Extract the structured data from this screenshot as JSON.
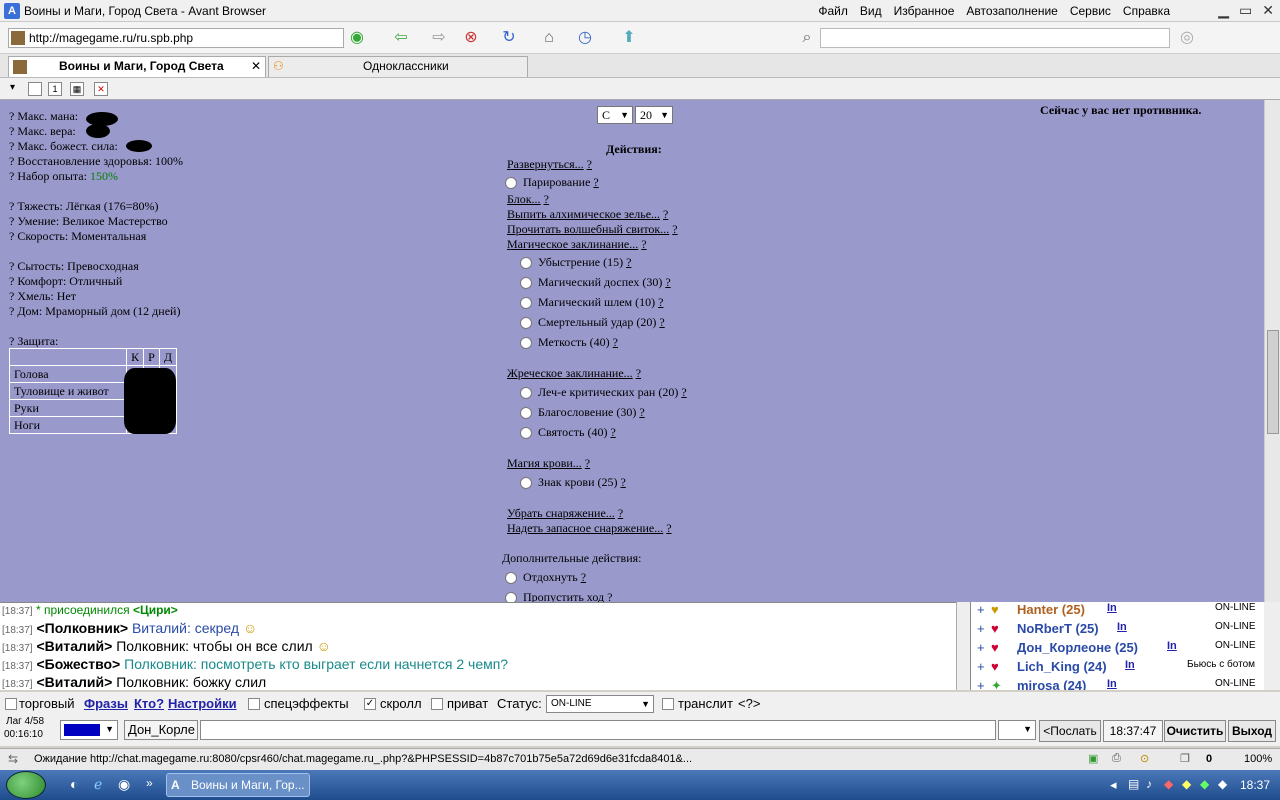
{
  "window": {
    "title": "Воины и Маги, Город Света - Avant Browser"
  },
  "menu": [
    "Файл",
    "Вид",
    "Избранное",
    "Автозаполнение",
    "Сервис",
    "Справка"
  ],
  "address": {
    "url": "http://magegame.ru/ru.spb.php"
  },
  "tabs": [
    {
      "label": "Воины и Маги, Город Света"
    },
    {
      "label": "Одноклассники"
    }
  ],
  "stats": {
    "max_mana": "? Макс. мана:",
    "max_faith": "? Макс. вера:",
    "max_divine": "? Макс. божест. сила:",
    "regen": "? Восстановление здоровья: 100%",
    "exp_label": "? Набор опыта:",
    "exp_value": "150%",
    "weight": "? Тяжесть: Лёгкая (176=80%)",
    "skill": "? Умение: Великое Мастерство",
    "speed": "? Скорость: Моментальная",
    "satiety": "? Сытость: Превосходная",
    "comfort": "? Комфорт: Отличный",
    "drunk": "? Хмель: Нет",
    "house": "? Дом: Мраморный дом (12 дней)",
    "defense": "? Защита:"
  },
  "defense_table": {
    "headers": [
      "К",
      "Р",
      "Д"
    ],
    "rows": [
      "Голова",
      "Туловище и живот",
      "Руки",
      "Ноги"
    ]
  },
  "selects": {
    "s1": "С",
    "s2": "20"
  },
  "opponent": "Сейчас у вас нет противника.",
  "actions": {
    "title": "Действия:",
    "turn": "Развернуться...",
    "parry": "Парирование",
    "block": "Блок...",
    "potion": "Выпить алхимическое зелье...",
    "scroll": "Прочитать волшебный свиток...",
    "magic": "Магическое заклинание...",
    "magic_items": [
      "Убыстрение (15)",
      "Магический доспех (30)",
      "Магический шлем (10)",
      "Смертельный удар (20)",
      "Меткость (40)"
    ],
    "priest": "Жреческое заклинание...",
    "priest_items": [
      "Леч-е критических ран (20)",
      "Благословение (30)",
      "Святость (40)"
    ],
    "blood": "Магия крови...",
    "blood_items": [
      "Знак крови (25)"
    ],
    "remove": "Убрать снаряжение...",
    "equip": "Надеть запасное снаряжение...",
    "extra_title": "Дополнительные действия:",
    "rest": "Отдохнуть",
    "skip": "Пропустить ход",
    "help": "?"
  },
  "chat": [
    {
      "time": "[18:37]",
      "star": "*",
      "text": "присоединился",
      "name": "<Цири>"
    },
    {
      "time": "[18:37]",
      "name": "<Полковник>",
      "msg": "Виталий: секред"
    },
    {
      "time": "[18:37]",
      "name": "<Виталий>",
      "msg": "Полковник: чтобы он все слил"
    },
    {
      "time": "[18:37]",
      "name": "<Божество>",
      "msg": "Полковник: посмотреть кто выграет если начнется 2 чемп?"
    },
    {
      "time": "[18:37]",
      "name": "<Виталий>",
      "msg": "Полковник: божку слил"
    }
  ],
  "users": [
    {
      "plus": "+",
      "name": "Hanter (25)",
      "link": "In",
      "status": "ON-LINE",
      "color": "#b06020"
    },
    {
      "plus": "+",
      "name": "NoRberT (25)",
      "link": "In",
      "status": "ON-LINE",
      "color": "#2a4aa8"
    },
    {
      "plus": "+",
      "name": "Дон_Корлеоне (25)",
      "link": "In",
      "status": "ON-LINE",
      "color": "#2a4aa8"
    },
    {
      "plus": "+",
      "name": "Lich_King (24)",
      "link": "In",
      "status": "Бьюсь с ботом",
      "color": "#2a4aa8"
    },
    {
      "plus": "+",
      "name": "mirosa (24)",
      "link": "In",
      "status": "ON-LINE",
      "color": "#2a4aa8"
    }
  ],
  "chat_opts": {
    "trade": "торговый",
    "phrases": "Фразы",
    "who": "Кто?",
    "settings": "Настройки",
    "effects": "спецэффекты",
    "scroll": "скролл",
    "private": "приват",
    "status_label": "Статус:",
    "status_value": "ON-LINE",
    "translit": "транслит",
    "translit_help": "<?>"
  },
  "input_row": {
    "lag": "Лаг 4/58",
    "time": "00:16:10",
    "nick": "Дон_Корле",
    "send": "<Послать",
    "clock": "18:37:47",
    "clear": "Очистить",
    "exit": "Выход"
  },
  "statusbar": {
    "text": "Ожидание http://chat.magegame.ru:8080/cpsr460/chat.magegame.ru_.php?&PHPSESSID=4b87c701b75e5a72d69d6e31fcda8401&...",
    "count": "0",
    "zoom": "100%"
  },
  "taskbar": {
    "item": "Воины и Маги, Гор...",
    "clock": "18:37"
  },
  "colors": {
    "game_bg": "#9999cc",
    "green": "#008000",
    "link_blue": "#2a4aa8"
  }
}
